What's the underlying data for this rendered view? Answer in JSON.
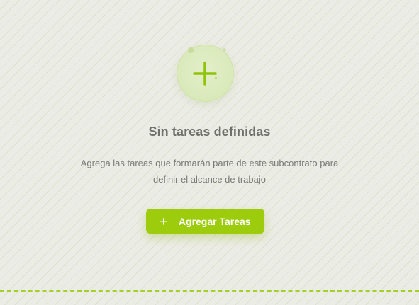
{
  "empty_state": {
    "icon": "plus-icon",
    "title": "Sin tareas definidas",
    "description_line1": "Agrega las tareas que formarán parte de este subcontrato para",
    "description_line2": "definir el alcance de trabajo",
    "button": {
      "icon_glyph": "+",
      "label": "Agregar Tareas"
    }
  },
  "colors": {
    "accent": "#9ccc0c",
    "title": "#6f6f6b",
    "text": "#7a7a76",
    "background": "#ecece6",
    "icon_circle": "#dbeabc"
  }
}
